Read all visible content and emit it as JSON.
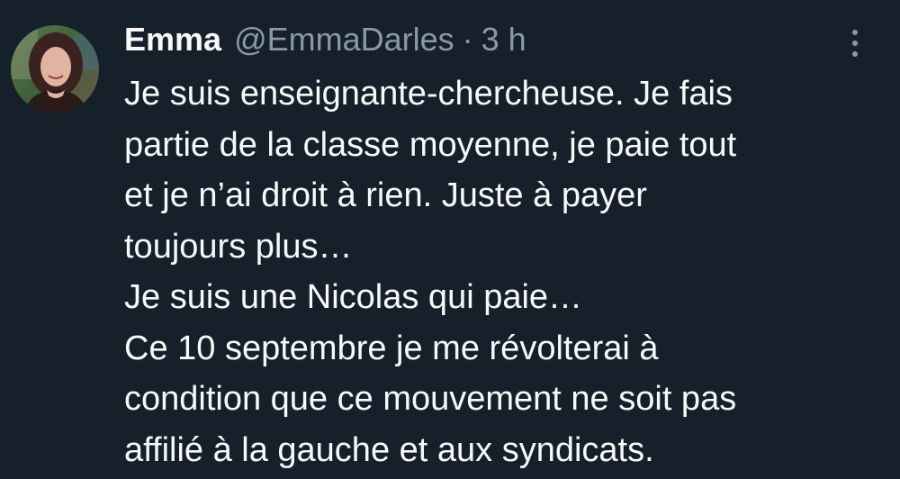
{
  "tweet": {
    "author": {
      "display_name": "Emma",
      "handle": "@EmmaDarles",
      "separator": "·",
      "time": "3 h",
      "avatar_icon": "profile-photo"
    },
    "more_icon": "more-vertical-icon",
    "lines": [
      "Je suis enseignante-chercheuse. Je fais",
      "partie de la classe moyenne, je paie tout",
      "et je n’ai droit à rien. Juste à payer",
      "toujours plus…",
      "Je suis une Nicolas qui paie…",
      "Ce 10 septembre je me révolterai à",
      "condition que ce mouvement ne soit pas",
      "affilié à la gauche et aux syndicats."
    ]
  },
  "colors": {
    "background": "#15202b",
    "text_primary": "#f7f9f9",
    "text_secondary": "#8b98a5"
  }
}
